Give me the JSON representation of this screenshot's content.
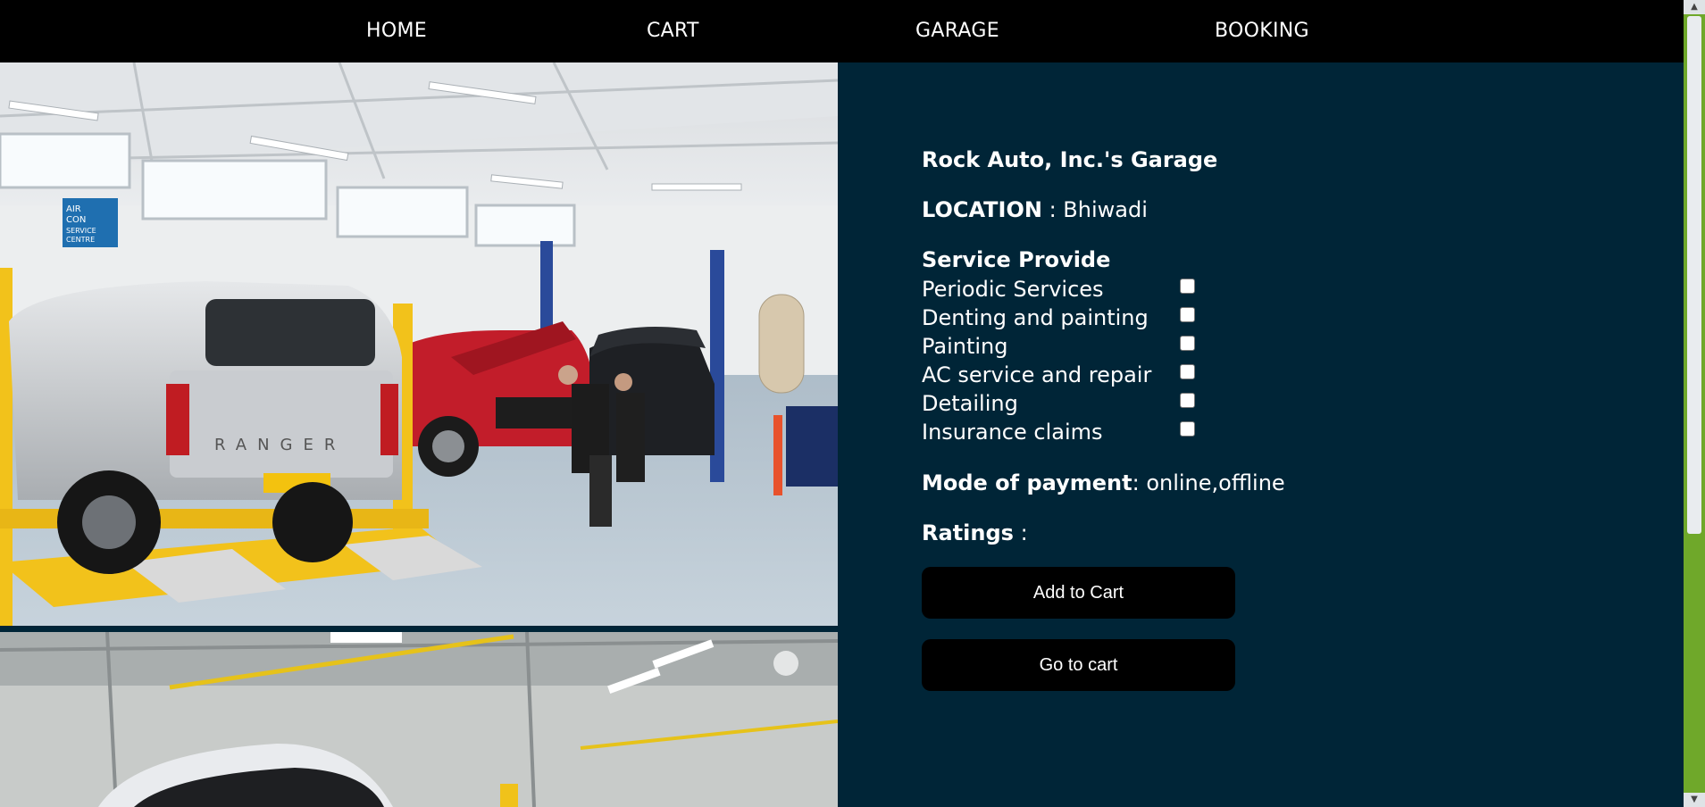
{
  "nav": {
    "items": [
      {
        "label": "HOME"
      },
      {
        "label": "CART"
      },
      {
        "label": "GARAGE"
      },
      {
        "label": "BOOKING"
      }
    ]
  },
  "garage": {
    "title": "Rock Auto, Inc.'s Garage",
    "location_label": "LOCATION",
    "location_sep": " : ",
    "location_value": "Bhiwadi",
    "services_title": "Service Provide",
    "services": [
      {
        "label": "Periodic Services",
        "checked": false
      },
      {
        "label": "Denting and painting",
        "checked": false
      },
      {
        "label": "Painting",
        "checked": false
      },
      {
        "label": "AC service and repair",
        "checked": false
      },
      {
        "label": "Detailing",
        "checked": false
      },
      {
        "label": "Insurance claims",
        "checked": false
      }
    ],
    "payment_label": "Mode of payment",
    "payment_sep": ": ",
    "payment_value": "online,offline",
    "ratings_label": "Ratings",
    "ratings_sep": " :",
    "add_to_cart_label": "Add to Cart",
    "go_to_cart_label": "Go to cart"
  },
  "photos": {
    "main_sign_text": "AIR CON SERVICE CENTRE",
    "truck_model_text": "RANGER"
  },
  "colors": {
    "nav_bg": "#000000",
    "panel_bg": "#002537",
    "button_bg": "#000000",
    "scrollbar_track": "#6fa82a"
  }
}
